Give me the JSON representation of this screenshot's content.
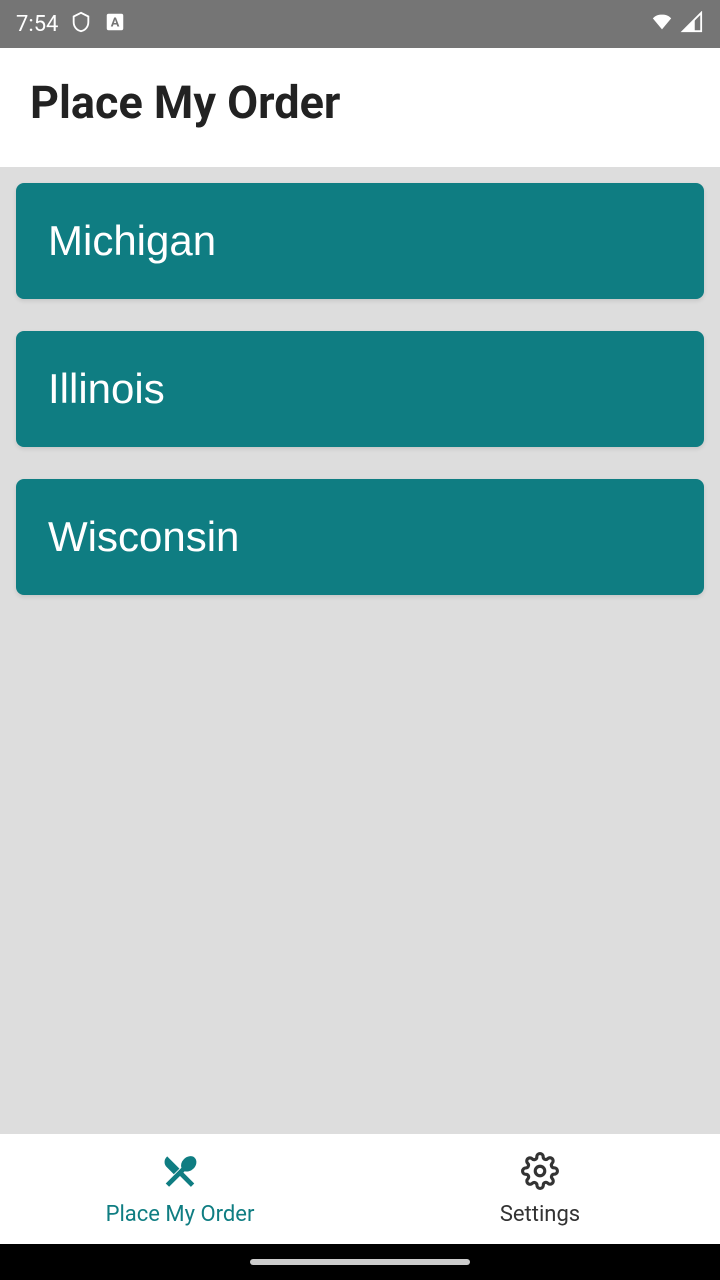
{
  "status": {
    "time": "7:54"
  },
  "header": {
    "title": "Place My Order"
  },
  "states": [
    {
      "name": "Michigan"
    },
    {
      "name": "Illinois"
    },
    {
      "name": "Wisconsin"
    }
  ],
  "nav": {
    "order": "Place My Order",
    "settings": "Settings"
  }
}
